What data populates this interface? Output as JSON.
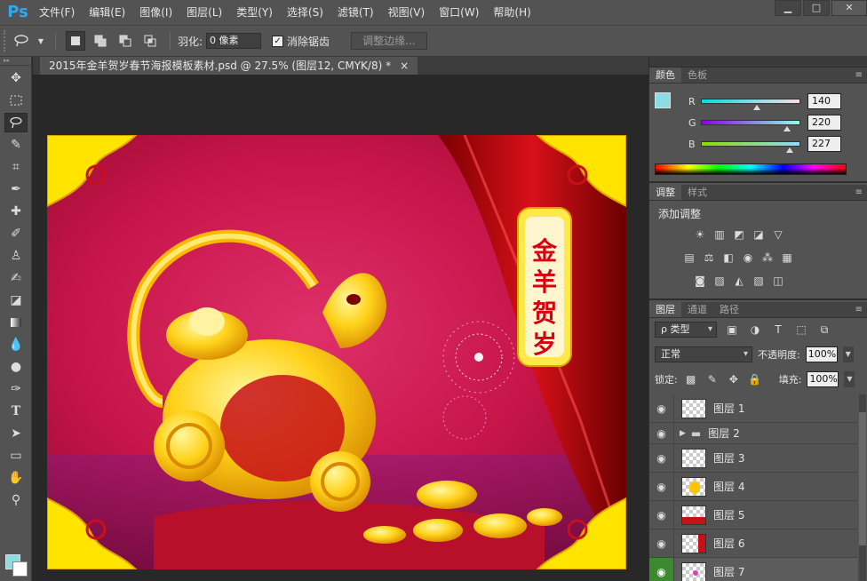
{
  "app": {
    "logo": "Ps"
  },
  "menubar": {
    "items": [
      "文件(F)",
      "编辑(E)",
      "图像(I)",
      "图层(L)",
      "类型(Y)",
      "选择(S)",
      "滤镜(T)",
      "视图(V)",
      "窗口(W)",
      "帮助(H)"
    ]
  },
  "window_controls": {
    "minimize": "▁",
    "maximize": "□",
    "close": "✕"
  },
  "options": {
    "feather_label": "羽化:",
    "feather_value": "0 像素",
    "antialias_label": "消除锯齿",
    "refine_button": "调整边缘..."
  },
  "document": {
    "tab_title": "2015年金羊贺岁春节海报模板素材.psd @ 27.5% (图层12, CMYK/8) *",
    "close": "×"
  },
  "poster": {
    "banner_text": [
      "金",
      "羊",
      "贺",
      "岁"
    ]
  },
  "color_panel": {
    "tabs": [
      "颜色",
      "色板"
    ],
    "fg_color": "#8cdce3",
    "channels": [
      {
        "name": "R",
        "value": "140"
      },
      {
        "name": "G",
        "value": "220"
      },
      {
        "name": "B",
        "value": "227"
      }
    ]
  },
  "adjustments_panel": {
    "tabs": [
      "调整",
      "样式"
    ],
    "title": "添加调整"
  },
  "layers_panel": {
    "tabs": [
      "图层",
      "通道",
      "路径"
    ],
    "filter_kind": "ρ 类型",
    "blend_mode": "正常",
    "opacity_label": "不透明度:",
    "opacity_value": "100%",
    "lock_label": "锁定:",
    "fill_label": "填充:",
    "fill_value": "100%",
    "layers": [
      {
        "name": "图层 1",
        "type": "layer"
      },
      {
        "name": "图层 2",
        "type": "group"
      },
      {
        "name": "图层 3",
        "type": "layer"
      },
      {
        "name": "图层 4",
        "type": "layer"
      },
      {
        "name": "图层 5",
        "type": "layer"
      },
      {
        "name": "图层 6",
        "type": "layer"
      },
      {
        "name": "图层 7",
        "type": "layer"
      }
    ]
  }
}
